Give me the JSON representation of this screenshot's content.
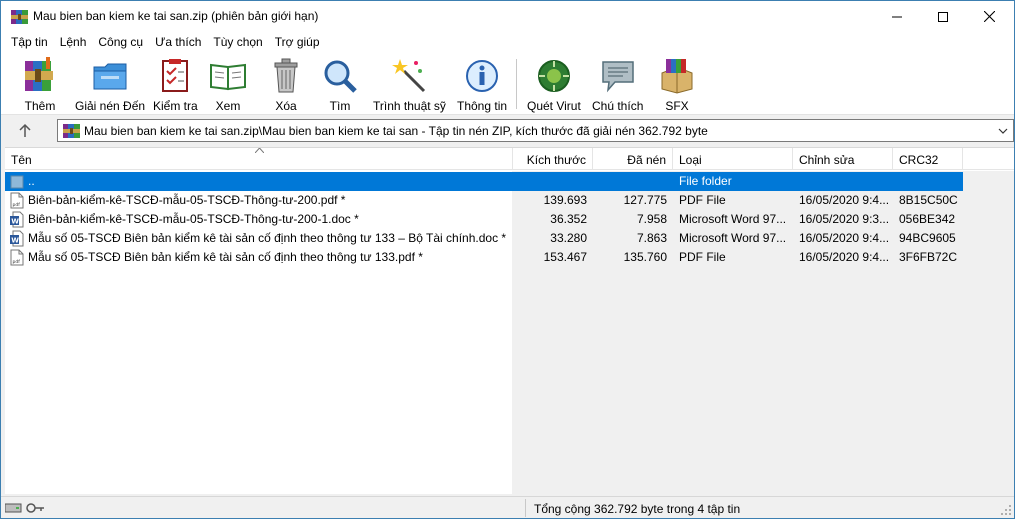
{
  "window": {
    "title": "Mau bien ban kiem ke tai san.zip (phiên bản giới hạn)"
  },
  "menu": [
    {
      "label": "Tập tin",
      "name": "menu-file"
    },
    {
      "label": "Lệnh",
      "name": "menu-commands"
    },
    {
      "label": "Công cụ",
      "name": "menu-tools"
    },
    {
      "label": "Ưa thích",
      "name": "menu-favorites"
    },
    {
      "label": "Tùy chọn",
      "name": "menu-options"
    },
    {
      "label": "Trợ giúp",
      "name": "menu-help"
    }
  ],
  "toolbar": {
    "add": "Thêm",
    "extract": "Giải nén Đến",
    "test": "Kiểm tra",
    "view": "Xem",
    "delete": "Xóa",
    "find": "Tìm",
    "wizard": "Trình thuật sỹ",
    "info": "Thông tin",
    "virus": "Quét Virut",
    "comment": "Chú thích",
    "sfx": "SFX"
  },
  "address": {
    "text": "Mau bien ban kiem ke tai san.zip\\Mau bien ban kiem ke tai san - Tập tin nén ZIP, kích thước đã giải nén 362.792 byte"
  },
  "columns": {
    "name": "Tên",
    "size": "Kích thước",
    "packed": "Đã nén",
    "type": "Loại",
    "modified": "Chỉnh sửa",
    "crc": "CRC32"
  },
  "files": [
    {
      "name": "..",
      "size": "",
      "packed": "",
      "type": "File folder",
      "modified": "",
      "crc": "",
      "icon": "folder-up-icon",
      "selected": true
    },
    {
      "name": "Biên-bản-kiểm-kê-TSCĐ-mẫu-05-TSCĐ-Thông-tư-200.pdf *",
      "size": "139.693",
      "packed": "127.775",
      "type": "PDF File",
      "modified": "16/05/2020 9:4...",
      "crc": "8B15C50C",
      "icon": "pdf-icon",
      "selected": false
    },
    {
      "name": "Biên-bản-kiểm-kê-TSCĐ-mẫu-05-TSCĐ-Thông-tư-200-1.doc *",
      "size": "36.352",
      "packed": "7.958",
      "type": "Microsoft Word 97...",
      "modified": "16/05/2020 9:3...",
      "crc": "056BE342",
      "icon": "word-icon",
      "selected": false
    },
    {
      "name": "Mẫu số 05-TSCĐ Biên bản kiểm kê tài sản cố định theo thông tư 133 – Bộ Tài chính.doc *",
      "size": "33.280",
      "packed": "7.863",
      "type": "Microsoft Word 97...",
      "modified": "16/05/2020 9:4...",
      "crc": "94BC9605",
      "icon": "word-icon",
      "selected": false
    },
    {
      "name": "Mẫu số 05-TSCĐ Biên bản kiểm kê tài sản cố định theo thông tư 133.pdf *",
      "size": "153.467",
      "packed": "135.760",
      "type": "PDF File",
      "modified": "16/05/2020 9:4...",
      "crc": "3F6FB72C",
      "icon": "pdf-icon",
      "selected": false
    }
  ],
  "status": {
    "text": "Tổng cộng 362.792 byte trong 4 tập tin"
  },
  "colors": {
    "selection": "#0078d7",
    "window_border": "#3c7fb1"
  }
}
